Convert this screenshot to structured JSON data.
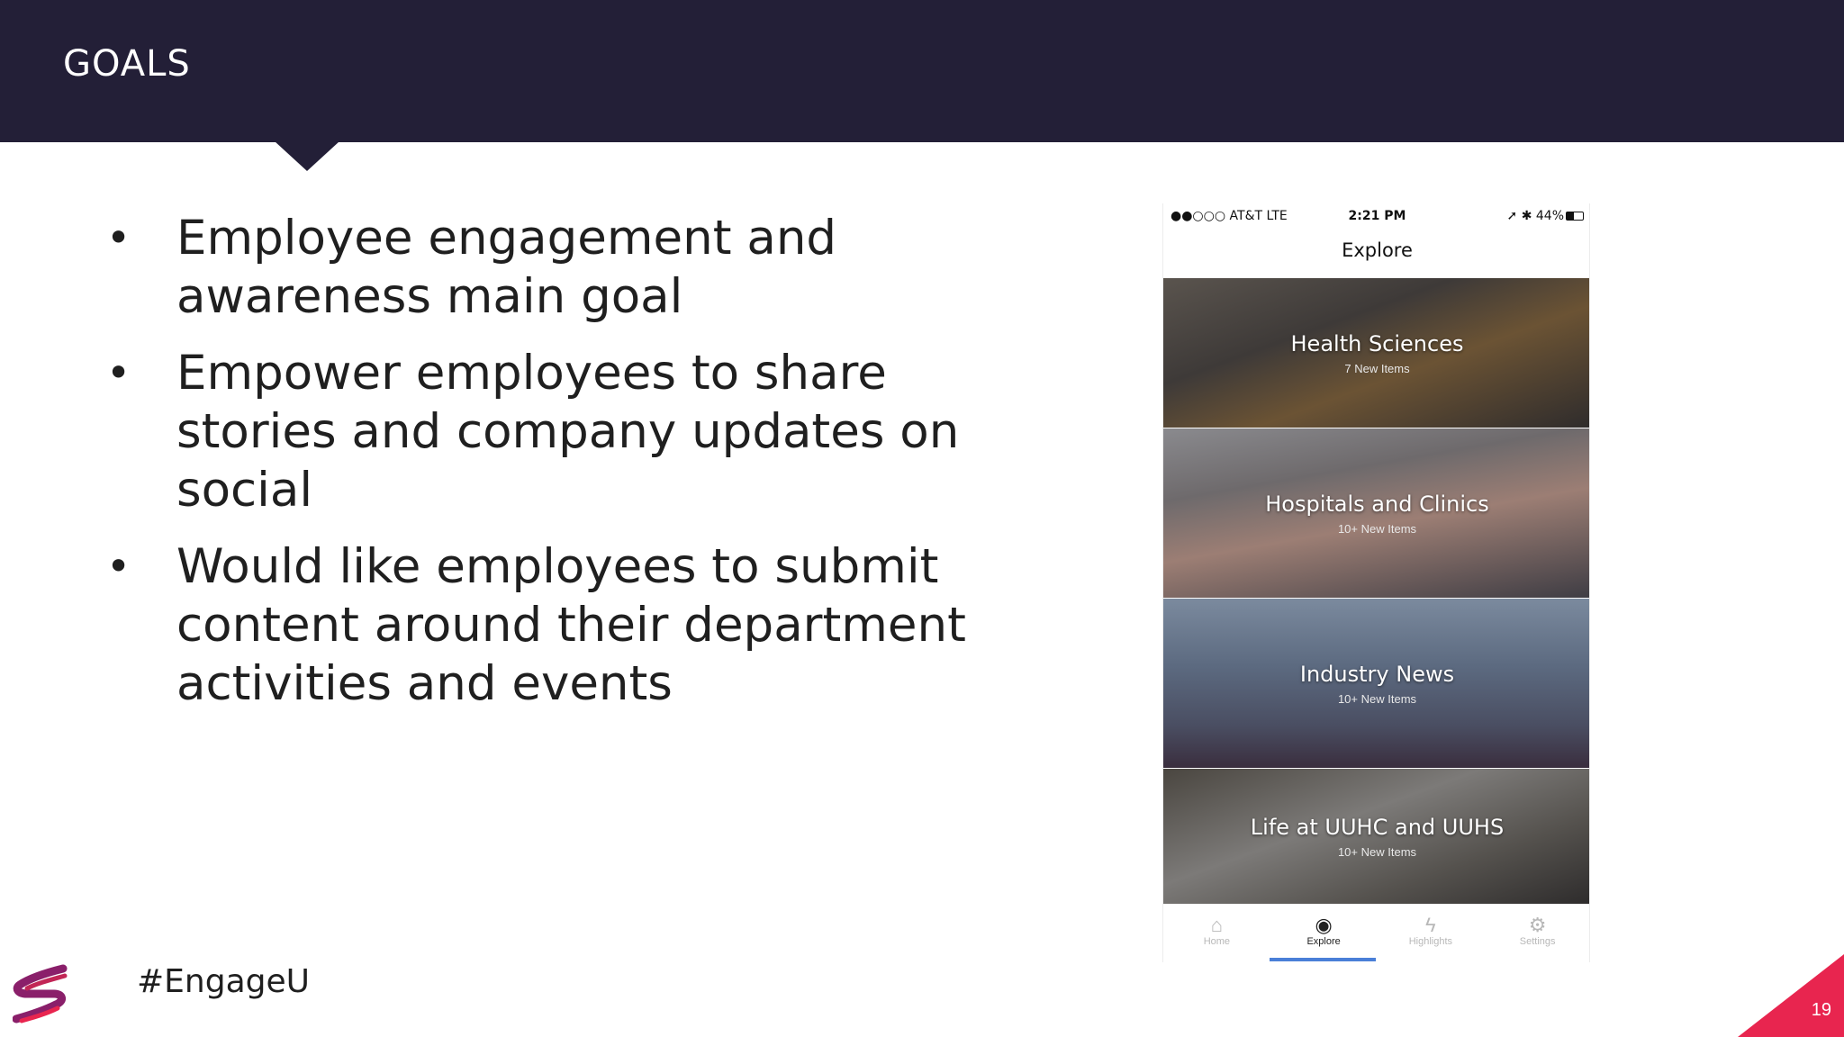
{
  "header": {
    "title": "GOALS"
  },
  "bullets": [
    "Employee engagement and awareness main goal",
    "Empower employees to share stories and company updates on social",
    "Would like employees to submit content around their department activities and events"
  ],
  "bullet_marker": "•",
  "phone": {
    "status": {
      "carrier": "●●○○○ AT&T  LTE",
      "time": "2:21 PM",
      "battery": "➚ ✱ 44%"
    },
    "nav_title": "Explore",
    "cards": [
      {
        "title": "Health Sciences",
        "subtitle": "7 New Items"
      },
      {
        "title": "Hospitals and Clinics",
        "subtitle": "10+ New Items"
      },
      {
        "title": "Industry News",
        "subtitle": "10+ New Items"
      },
      {
        "title": "Life at UUHC and UUHS",
        "subtitle": "10+ New Items"
      }
    ],
    "tabs": [
      {
        "label": "Home",
        "icon": "⌂"
      },
      {
        "label": "Explore",
        "icon": "◉"
      },
      {
        "label": "Highlights",
        "icon": "ϟ"
      },
      {
        "label": "Settings",
        "icon": "⚙"
      }
    ]
  },
  "footer": {
    "hashtag": "#EngageU",
    "page_number": "19"
  },
  "colors": {
    "header_bg": "#231f37",
    "accent_pink": "#e8254f",
    "tab_active": "#4a7fd8"
  }
}
